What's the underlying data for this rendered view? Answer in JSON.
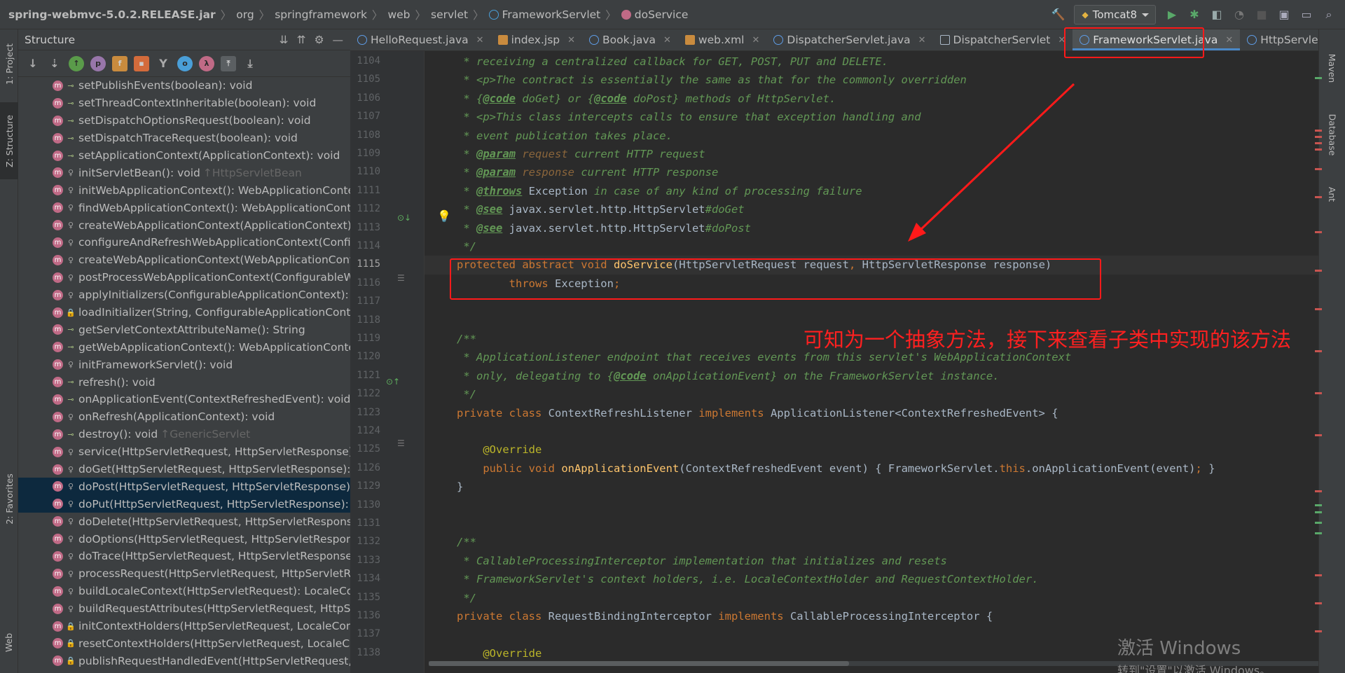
{
  "breadcrumb": {
    "items": [
      "spring-webmvc-5.0.2.RELEASE.jar",
      "org",
      "springframework",
      "web",
      "servlet",
      "FrameworkServlet",
      "doService"
    ]
  },
  "run_config": {
    "label": "Tomcat8"
  },
  "left_tool_tabs": [
    "1: Project",
    "Z: Structure",
    "2: Favorites",
    "Web"
  ],
  "right_tool_tabs": [
    "Maven",
    "Database",
    "Ant"
  ],
  "structure": {
    "title": "Structure",
    "items": [
      {
        "label": "setPublishEvents(boolean): void",
        "vis": "pub"
      },
      {
        "label": "setThreadContextInheritable(boolean): void",
        "vis": "pub"
      },
      {
        "label": "setDispatchOptionsRequest(boolean): void",
        "vis": "pub"
      },
      {
        "label": "setDispatchTraceRequest(boolean): void",
        "vis": "pub"
      },
      {
        "label": "setApplicationContext(ApplicationContext): void",
        "vis": "pub"
      },
      {
        "label": "initServletBean(): void",
        "vis": "prot",
        "inherited": "↑HttpServletBean"
      },
      {
        "label": "initWebApplicationContext(): WebApplicationConte",
        "vis": "prot"
      },
      {
        "label": "findWebApplicationContext(): WebApplicationConte",
        "vis": "prot"
      },
      {
        "label": "createWebApplicationContext(ApplicationContext):",
        "vis": "prot"
      },
      {
        "label": "configureAndRefreshWebApplicationContext(Confic",
        "vis": "prot"
      },
      {
        "label": "createWebApplicationContext(WebApplicationCont",
        "vis": "prot"
      },
      {
        "label": "postProcessWebApplicationContext(ConfigurableW",
        "vis": "prot"
      },
      {
        "label": "applyInitializers(ConfigurableApplicationContext): vc",
        "vis": "prot"
      },
      {
        "label": "loadInitializer(String, ConfigurableApplicationConte",
        "vis": "lock"
      },
      {
        "label": "getServletContextAttributeName(): String",
        "vis": "pub"
      },
      {
        "label": "getWebApplicationContext(): WebApplicationConte",
        "vis": "pub"
      },
      {
        "label": "initFrameworkServlet(): void",
        "vis": "prot"
      },
      {
        "label": "refresh(): void",
        "vis": "pub"
      },
      {
        "label": "onApplicationEvent(ContextRefreshedEvent): void",
        "vis": "pub"
      },
      {
        "label": "onRefresh(ApplicationContext): void",
        "vis": "prot"
      },
      {
        "label": "destroy(): void",
        "vis": "pub",
        "inherited": "↑GenericServlet"
      },
      {
        "label": "service(HttpServletRequest, HttpServletResponse):",
        "vis": "prot"
      },
      {
        "label": "doGet(HttpServletRequest, HttpServletResponse): v",
        "vis": "prot"
      },
      {
        "label": "doPost(HttpServletRequest, HttpServletResponse):",
        "vis": "prot",
        "highlight": true
      },
      {
        "label": "doPut(HttpServletRequest, HttpServletResponse): v",
        "vis": "prot",
        "highlight": true
      },
      {
        "label": "doDelete(HttpServletRequest, HttpServletResponse",
        "vis": "prot"
      },
      {
        "label": "doOptions(HttpServletRequest, HttpServletRespons",
        "vis": "prot"
      },
      {
        "label": "doTrace(HttpServletRequest, HttpServletResponse):",
        "vis": "prot"
      },
      {
        "label": "processRequest(HttpServletRequest, HttpServletRe",
        "vis": "prot"
      },
      {
        "label": "buildLocaleContext(HttpServletRequest): LocaleCon",
        "vis": "prot"
      },
      {
        "label": "buildRequestAttributes(HttpServletRequest, HttpSe",
        "vis": "prot"
      },
      {
        "label": "initContextHolders(HttpServletRequest, LocaleCont",
        "vis": "lock"
      },
      {
        "label": "resetContextHolders(HttpServletRequest, LocaleCo",
        "vis": "lock"
      },
      {
        "label": "publishRequestHandledEvent(HttpServletRequest, H",
        "vis": "lock"
      }
    ]
  },
  "tabs": [
    {
      "label": "HelloRequest.java",
      "icon": "class"
    },
    {
      "label": "index.jsp",
      "icon": "jsp"
    },
    {
      "label": "Book.java",
      "icon": "class"
    },
    {
      "label": "web.xml",
      "icon": "xml"
    },
    {
      "label": "DispatcherServlet.java",
      "icon": "class"
    },
    {
      "label": "DispatcherServlet",
      "icon": "grid"
    },
    {
      "label": "FrameworkServlet.java",
      "icon": "class",
      "active": true
    },
    {
      "label": "HttpServletBe",
      "icon": "class"
    }
  ],
  "line_numbers": [
    "1104",
    "1105",
    "1106",
    "1107",
    "1108",
    "1109",
    "1110",
    "1111",
    "1112",
    "1113",
    "1114",
    "1115",
    "1116",
    "1117",
    "1118",
    "1119",
    "1120",
    "1121",
    "1122",
    "1123",
    "1124",
    "1125",
    "1126",
    "1129",
    "1130",
    "1131",
    "1132",
    "1133",
    "1134",
    "1135",
    "1136",
    "1137",
    "1138"
  ],
  "code_lines": [
    [
      {
        "t": " * receiving a centralized callback for GET, POST, PUT and DELETE.",
        "c": "cm"
      }
    ],
    [
      {
        "t": " * <p>The contract is essentially the same as that for the commonly overridden",
        "c": "cm"
      }
    ],
    [
      {
        "t": " * {",
        "c": "cm"
      },
      {
        "t": "@code",
        "c": "ct"
      },
      {
        "t": " doGet} or {",
        "c": "cm"
      },
      {
        "t": "@code",
        "c": "ct"
      },
      {
        "t": " doPost} methods of HttpServlet.",
        "c": "cm"
      }
    ],
    [
      {
        "t": " * <p>This class intercepts calls to ensure that exception handling and",
        "c": "cm"
      }
    ],
    [
      {
        "t": " * event publication takes place.",
        "c": "cm"
      }
    ],
    [
      {
        "t": " * ",
        "c": "cm"
      },
      {
        "t": "@param",
        "c": "ct"
      },
      {
        "t": " request",
        "c": "cp"
      },
      {
        "t": " current HTTP request",
        "c": "cm"
      }
    ],
    [
      {
        "t": " * ",
        "c": "cm"
      },
      {
        "t": "@param",
        "c": "ct"
      },
      {
        "t": " response",
        "c": "cp"
      },
      {
        "t": " current HTTP response",
        "c": "cm"
      }
    ],
    [
      {
        "t": " * ",
        "c": "cm"
      },
      {
        "t": "@throws",
        "c": "ct"
      },
      {
        "t": " Exception",
        "c": ""
      },
      {
        "t": " in case of any kind of processing failure",
        "c": "cm"
      }
    ],
    [
      {
        "t": " * ",
        "c": "cm"
      },
      {
        "t": "@see",
        "c": "ct"
      },
      {
        "t": " javax.servlet.http.HttpServlet",
        "c": ""
      },
      {
        "t": "#doGet",
        "c": "cm"
      }
    ],
    [
      {
        "t": " * ",
        "c": "cm"
      },
      {
        "t": "@see",
        "c": "ct"
      },
      {
        "t": " javax.servlet.http.HttpServlet",
        "c": ""
      },
      {
        "t": "#doPost",
        "c": "cm"
      }
    ],
    [
      {
        "t": " */",
        "c": "cm"
      }
    ],
    [
      {
        "t": "protected abstract void ",
        "c": "kw"
      },
      {
        "t": "doService",
        "c": "fn"
      },
      {
        "t": "(HttpServletRequest request",
        "c": ""
      },
      {
        "t": ", ",
        "c": "kw"
      },
      {
        "t": "HttpServletResponse response)",
        "c": ""
      }
    ],
    [
      {
        "t": "        throws ",
        "c": "kw"
      },
      {
        "t": "Exception",
        "c": ""
      },
      {
        "t": ";",
        "c": "kw"
      }
    ],
    [],
    [],
    [
      {
        "t": "/**",
        "c": "cm"
      }
    ],
    [
      {
        "t": " * ApplicationListener endpoint that receives events from this servlet's WebApplicationContext",
        "c": "cm"
      }
    ],
    [
      {
        "t": " * only, delegating to {",
        "c": "cm"
      },
      {
        "t": "@code",
        "c": "ct"
      },
      {
        "t": " onApplicationEvent} on the FrameworkServlet instance.",
        "c": "cm"
      }
    ],
    [
      {
        "t": " */",
        "c": "cm"
      }
    ],
    [
      {
        "t": "private class ",
        "c": "kw"
      },
      {
        "t": "ContextRefreshListener ",
        "c": ""
      },
      {
        "t": "implements ",
        "c": "kw"
      },
      {
        "t": "ApplicationListener<ContextRefreshedEvent> {",
        "c": ""
      }
    ],
    [],
    [
      {
        "t": "    @Override",
        "c": "an"
      }
    ],
    [
      {
        "t": "    public void ",
        "c": "kw"
      },
      {
        "t": "onApplicationEvent",
        "c": "fn"
      },
      {
        "t": "(ContextRefreshedEvent event) { FrameworkServlet.",
        "c": ""
      },
      {
        "t": "this",
        "c": "kw"
      },
      {
        "t": ".onApplicationEvent(event)",
        "c": ""
      },
      {
        "t": "; ",
        "c": "kw"
      },
      {
        "t": "}",
        "c": ""
      }
    ],
    [
      {
        "t": "}",
        "c": ""
      }
    ],
    [],
    [],
    [
      {
        "t": "/**",
        "c": "cm"
      }
    ],
    [
      {
        "t": " * CallableProcessingInterceptor implementation that initializes and resets",
        "c": "cm"
      }
    ],
    [
      {
        "t": " * FrameworkServlet's context holders, i.e. LocaleContextHolder and RequestContextHolder.",
        "c": "cm"
      }
    ],
    [
      {
        "t": " */",
        "c": "cm"
      }
    ],
    [
      {
        "t": "private class ",
        "c": "kw"
      },
      {
        "t": "RequestBindingInterceptor ",
        "c": ""
      },
      {
        "t": "implements ",
        "c": "kw"
      },
      {
        "t": "CallableProcessingInterceptor {",
        "c": ""
      }
    ],
    [],
    [
      {
        "t": "    @Override",
        "c": "an"
      }
    ]
  ],
  "annotation": {
    "text": "可知为一个抽象方法，接下来查看子类中实现的该方法",
    "color": "#ff2020"
  },
  "watermark": {
    "line1": "激活 Windows",
    "line2": "转到\"设置\"以激活 Windows。"
  },
  "colors": {
    "keyword": "#cc7832",
    "comment": "#629755",
    "function": "#ffc66d",
    "annotation_red": "#ff1a1a",
    "tab_underline": "#4a88c7"
  }
}
